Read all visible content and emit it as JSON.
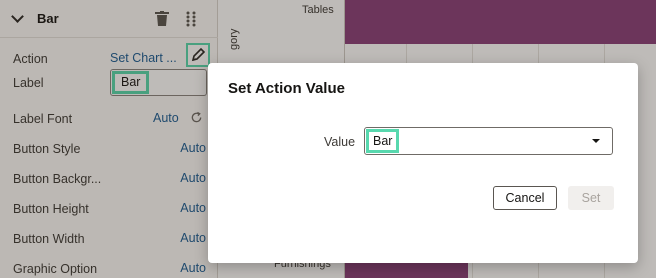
{
  "panel": {
    "title": "Bar",
    "rows": {
      "action": {
        "label": "Action",
        "value": "Set Chart ..."
      },
      "label": {
        "label": "Label",
        "value": "Bar"
      },
      "label_font": {
        "label": "Label Font",
        "value": "Auto"
      },
      "button_style": {
        "label": "Button Style",
        "value": "Auto"
      },
      "button_background": {
        "label": "Button Backgr...",
        "value": "Auto"
      },
      "button_height": {
        "label": "Button Height",
        "value": "Auto"
      },
      "button_width": {
        "label": "Button Width",
        "value": "Auto"
      },
      "graphic_option": {
        "label": "Graphic Option",
        "value": "Auto"
      }
    }
  },
  "chart": {
    "category_top": "Tables",
    "category_bottom": "Furnishings",
    "axis_title_fragment": "gory",
    "bar_color": "#8a3f7a"
  },
  "dialog": {
    "title": "Set Action Value",
    "field_label": "Value",
    "field_value": "Bar",
    "cancel_label": "Cancel",
    "set_label": "Set"
  },
  "colors": {
    "highlight": "#58d8ae",
    "link": "#1c5d95"
  }
}
